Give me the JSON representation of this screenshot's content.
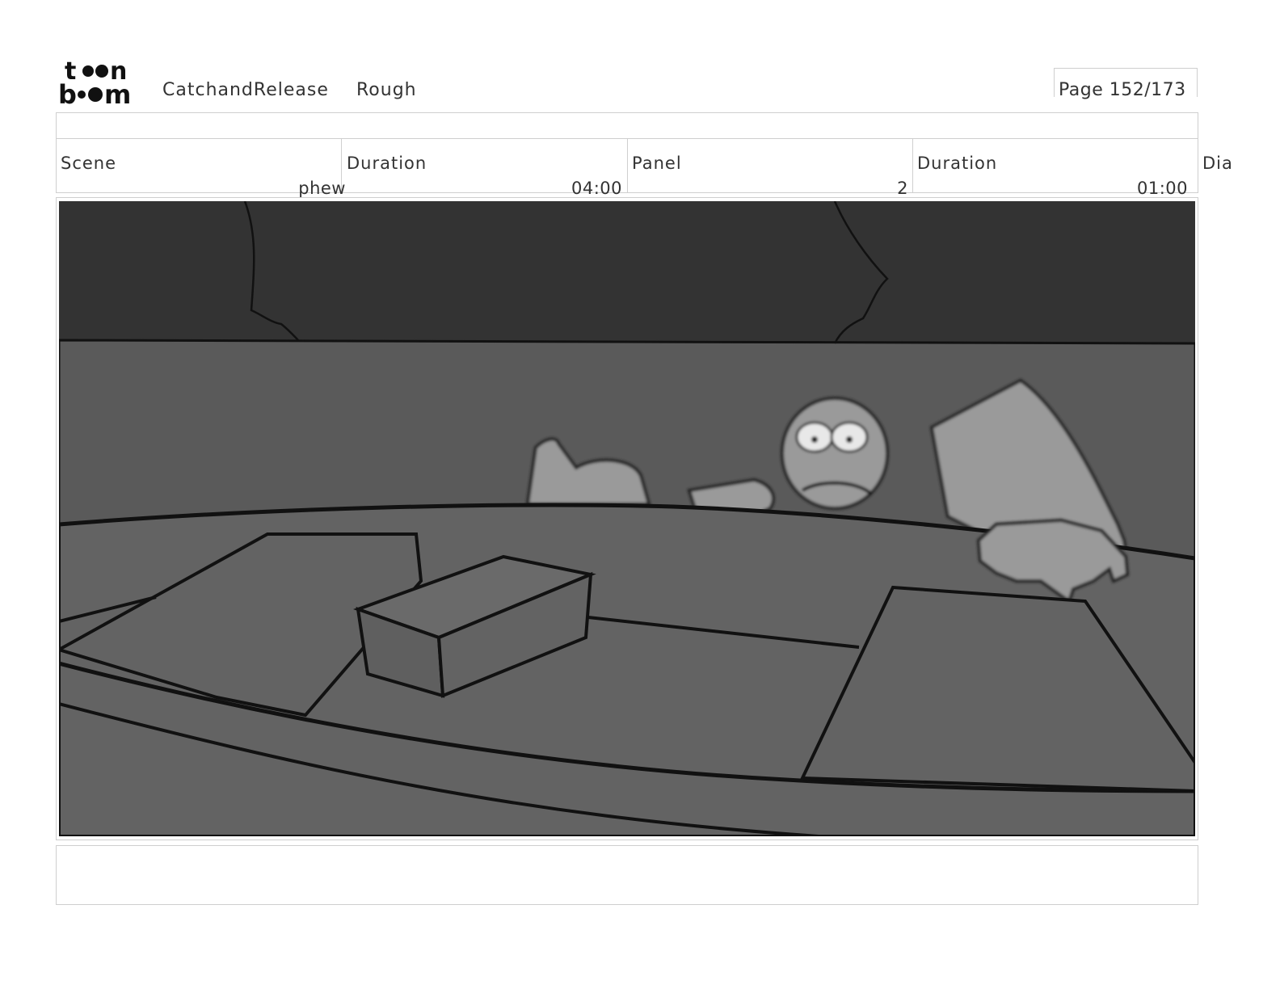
{
  "header": {
    "logo_top": "t",
    "logo_top_end": "n",
    "logo_bottom": "b",
    "logo_bottom_end": "m",
    "project": "CatchandRelease",
    "stage": "Rough",
    "page": "Page 152/173"
  },
  "info": {
    "scene_label": "Scene",
    "scene_value": "phew",
    "scene_duration_label": "Duration",
    "scene_duration_value": "04:00",
    "panel_label": "Panel",
    "panel_value": "2",
    "panel_duration_label": "Duration",
    "panel_duration_value": "01:00",
    "dialogue_label": "Dia"
  },
  "colors": {
    "sky": "#333333",
    "water": "#5a5a5a",
    "boat": "#636363",
    "character": "#9a9a9a",
    "ink": "#111111"
  }
}
